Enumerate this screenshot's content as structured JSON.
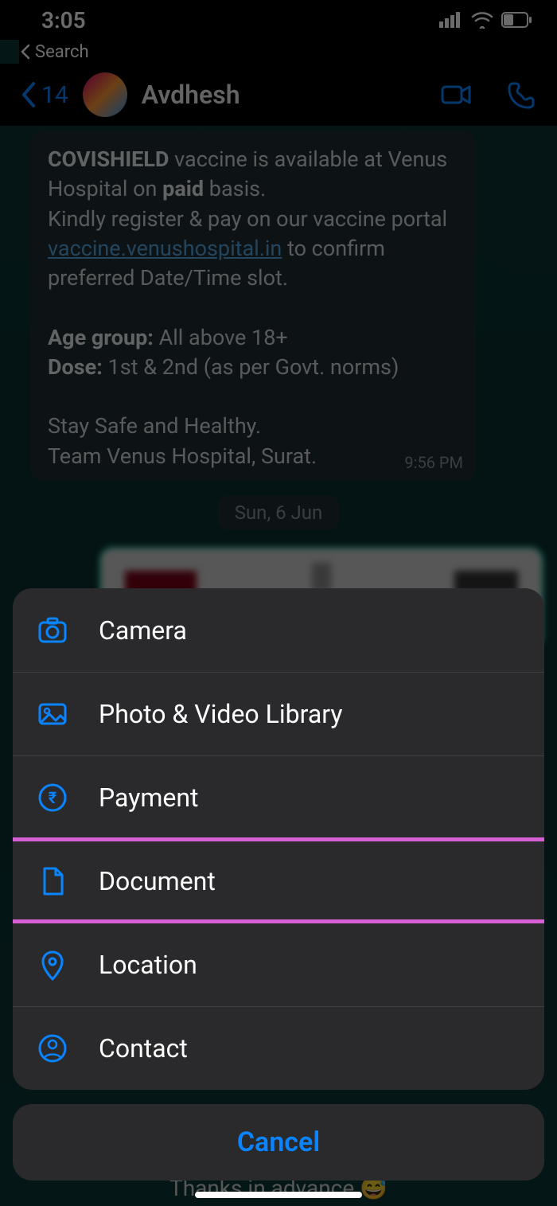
{
  "status": {
    "time": "3:05",
    "back_label": "Search"
  },
  "header": {
    "back_count": "14",
    "name": "Avdhesh"
  },
  "message": {
    "line1a": "COVISHIELD",
    "line1b": " vaccine is available at Venus Hospital on ",
    "line1c": "paid",
    "line1d": " basis.",
    "line2a": "Kindly register & pay on our vaccine portal ",
    "link": "vaccine.venushospital.in",
    "line2b": " to confirm preferred Date/Time slot.",
    "age_label": "Age group:",
    "age_val": " All above 18+",
    "dose_label": "Dose:",
    "dose_val": " 1st & 2nd (as per Govt. norms)",
    "closing1": "Stay Safe and Healthy.",
    "closing2": "Team Venus Hospital, Surat.",
    "time": "9:56 PM"
  },
  "date_chip": "Sun, 6 Jun",
  "thanks": "Thanks in advance 😅",
  "sheet": {
    "camera": "Camera",
    "photo": "Photo & Video Library",
    "payment": "Payment",
    "document": "Document",
    "location": "Location",
    "contact": "Contact",
    "cancel": "Cancel"
  }
}
